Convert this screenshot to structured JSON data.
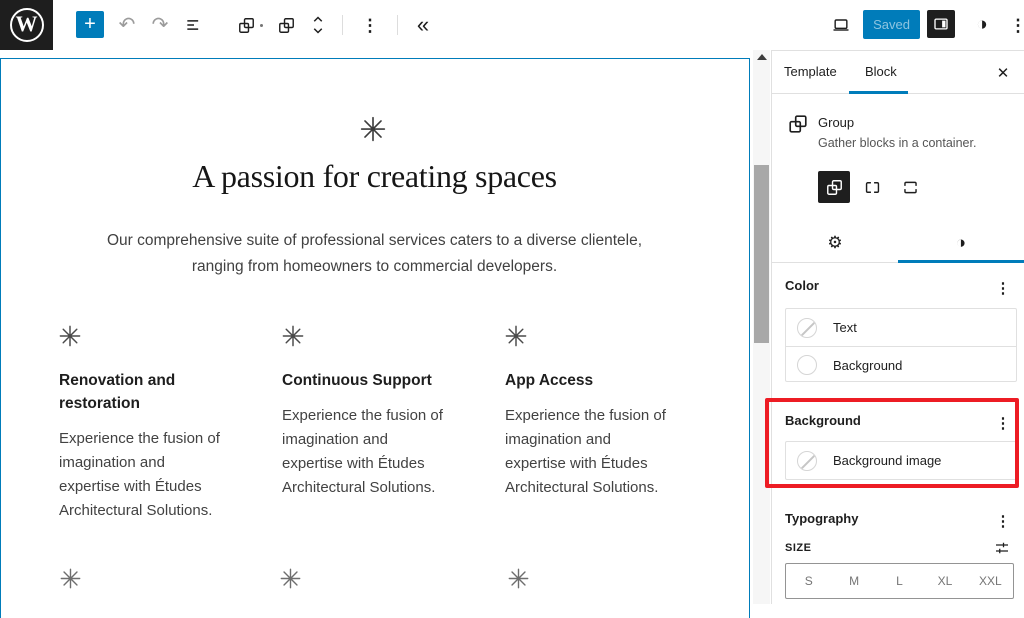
{
  "colors": {
    "accent": "#007cba",
    "highlight_red": "#ed1c24",
    "toolbar_dark": "#1e1e1e"
  },
  "icons": {
    "wordpress_letter": "W",
    "add": "+",
    "undo": "↶",
    "redo": "↷",
    "more": "⋮",
    "collapse": "«",
    "close": "✕",
    "styles_half_circle": "◑",
    "settings_gear": "⚙"
  },
  "topbar": {
    "saved_label": "Saved"
  },
  "sidebar": {
    "tabs": {
      "template": "Template",
      "block": "Block"
    },
    "block_card": {
      "title": "Group",
      "description": "Gather blocks in a container."
    },
    "color": {
      "title": "Color",
      "rows": [
        {
          "label": "Text"
        },
        {
          "label": "Background"
        }
      ]
    },
    "background": {
      "title": "Background",
      "rows": [
        {
          "label": "Background image"
        }
      ]
    },
    "typography": {
      "title": "Typography",
      "size_label": "SIZE",
      "sizes": [
        "S",
        "M",
        "L",
        "XL",
        "XXL"
      ]
    }
  },
  "canvas": {
    "heading": "A passion for creating spaces",
    "intro_line1": "Our comprehensive suite of professional services caters to a diverse clientele,",
    "intro_line2": "ranging from homeowners to commercial developers.",
    "columns": [
      {
        "title_line1": "Renovation and",
        "title_line2": "restoration",
        "body": [
          "Experience the fusion of",
          "imagination and",
          "expertise with Études",
          "Architectural Solutions."
        ]
      },
      {
        "title_line1": "Continuous Support",
        "title_line2": "",
        "body": [
          "Experience the fusion of",
          "imagination and",
          "expertise with Études",
          "Architectural Solutions."
        ]
      },
      {
        "title_line1": "App Access",
        "title_line2": "",
        "body": [
          "Experience the fusion of",
          "imagination and",
          "expertise with Études",
          "Architectural Solutions."
        ]
      }
    ]
  }
}
